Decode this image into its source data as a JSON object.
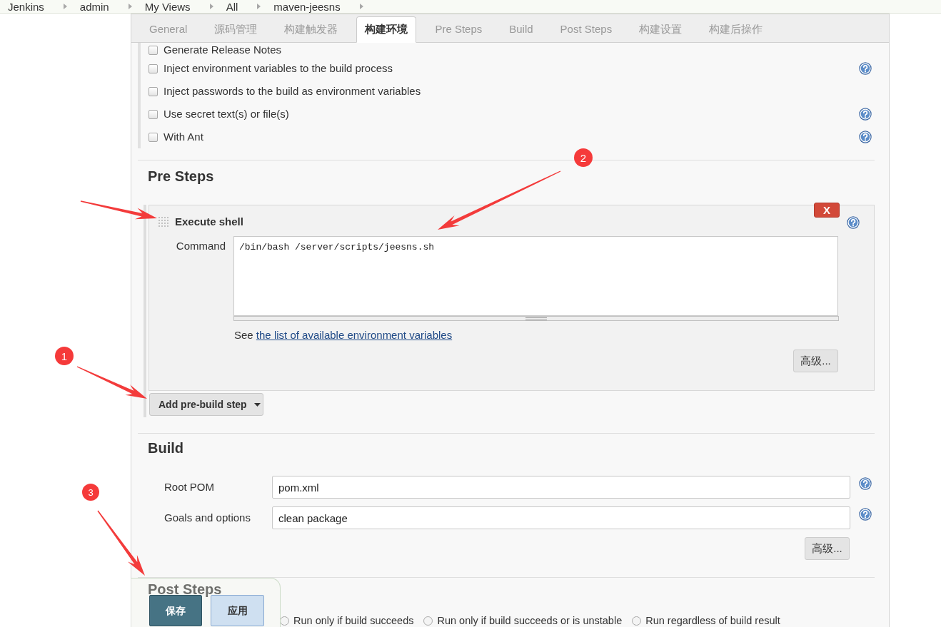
{
  "breadcrumb": [
    {
      "label": "Jenkins"
    },
    {
      "label": "admin"
    },
    {
      "label": "My Views"
    },
    {
      "label": "All"
    },
    {
      "label": "maven-jeesns"
    }
  ],
  "tabs": [
    {
      "label": "General",
      "selected": false
    },
    {
      "label": "源码管理",
      "selected": false
    },
    {
      "label": "构建触发器",
      "selected": false
    },
    {
      "label": "构建环境",
      "selected": true
    },
    {
      "label": "Pre Steps",
      "selected": false
    },
    {
      "label": "Build",
      "selected": false
    },
    {
      "label": "Post Steps",
      "selected": false
    },
    {
      "label": "构建设置",
      "selected": false
    },
    {
      "label": "构建后操作",
      "selected": false
    }
  ],
  "build_environment": {
    "options": [
      {
        "label": "Generate Release Notes",
        "checked": false,
        "help": false
      },
      {
        "label": "Inject environment variables to the build process",
        "checked": false,
        "help": true
      },
      {
        "label": "Inject passwords to the build as environment variables",
        "checked": false,
        "help": false
      },
      {
        "label": "Use secret text(s) or file(s)",
        "checked": false,
        "help": true
      },
      {
        "label": "With Ant",
        "checked": false,
        "help": true
      }
    ]
  },
  "pre_steps": {
    "title": "Pre Steps",
    "steps": [
      {
        "title": "Execute shell",
        "delete_label": "X",
        "help": true,
        "command_label": "Command",
        "command": "/bin/bash /server/scripts/jeesns.sh",
        "note": "See",
        "note_link": "the list of available environment variables",
        "advanced_button": "高级..."
      }
    ],
    "add_button": "Add pre-build step"
  },
  "build": {
    "title": "Build",
    "fields": [
      {
        "label": "Root POM",
        "value": "pom.xml",
        "help": true
      },
      {
        "label": "Goals and options",
        "value": "clean package",
        "help": true
      }
    ],
    "advanced_button": "高级..."
  },
  "post_steps": {
    "title": "Post Steps",
    "options": [
      {
        "label": "Run only if build succeeds",
        "selected": false
      },
      {
        "label": "Run only if build succeeds or is unstable",
        "selected": false
      },
      {
        "label": "Run regardless of build result",
        "selected": false
      }
    ]
  },
  "save_bar": {
    "buttons": [
      {
        "label": "保存",
        "kind": "primary"
      },
      {
        "label": "应用",
        "kind": "secondary"
      }
    ]
  },
  "annotations": [
    {
      "label": "1"
    },
    {
      "label": "2"
    },
    {
      "label": "3"
    }
  ]
}
